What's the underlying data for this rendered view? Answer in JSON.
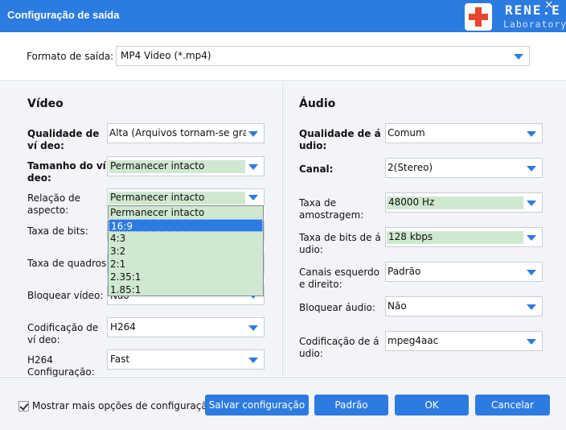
{
  "window": {
    "title": "Configuração de saída",
    "close_label": "×",
    "logo_name": "RENE.E",
    "logo_sub": "Laboratory"
  },
  "format": {
    "label": "Formato de saída:",
    "value": "MP4 Video (*.mp4)"
  },
  "video": {
    "title": "Vídeo",
    "quality_label": "Qualidade de ví deo:",
    "quality_value": "Alta (Arquivos tornam-se grand",
    "size_label": "Tamanho do ví deo:",
    "size_value": "Permanecer intacto",
    "aspect_label": "Relação de aspecto:",
    "aspect_value": "Permanecer intacto",
    "bitrate_label": "Taxa de bits:",
    "framerate_label": "Taxa de quadros:",
    "lock_label": "Bloquear vídeo:",
    "lock_value": "Não",
    "codec_label": "Codificação de ví deo:",
    "codec_value": "H264",
    "h264_label": "H264 Configuração:",
    "h264_value": "Fast"
  },
  "aspect_dropdown": {
    "options": [
      "Permanecer intacto",
      "16:9",
      "4:3",
      "3:2",
      "2:1",
      "2.35:1",
      "1.85:1"
    ],
    "selected": "16:9"
  },
  "audio": {
    "title": "Áudio",
    "quality_label": "Qualidade de á udio:",
    "quality_value": "Comum",
    "channel_label": "Canal:",
    "channel_value": "2(Stereo)",
    "samplerate_label": "Taxa de amostragem:",
    "samplerate_value": "48000 Hz",
    "bitrate_label": "Taxa de bits de á udio:",
    "bitrate_value": "128 kbps",
    "lr_label": "Canais esquerdo e direito:",
    "lr_value": "Padrão",
    "lock_label": "Bloquear áudio:",
    "lock_value": "Não",
    "codec_label": "Codificação de á udio:",
    "codec_value": "mpeg4aac"
  },
  "footer": {
    "more_options_label": "Mostrar mais opções de configuração",
    "save_label": "Salvar configuração",
    "default_label": "Padrão",
    "ok_label": "OK",
    "cancel_label": "Cancelar"
  },
  "colors": {
    "accent": "#2c7be0",
    "panel_bg": "#f2f4f7",
    "highlight_green": "#cfe8cf"
  }
}
